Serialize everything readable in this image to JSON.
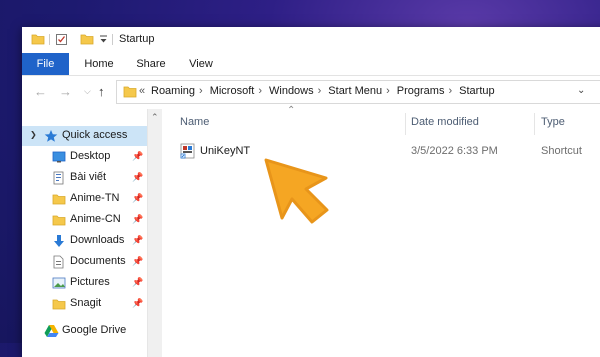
{
  "window": {
    "title": "Startup"
  },
  "ribbon": {
    "tabs": [
      {
        "label": "File"
      },
      {
        "label": "Home"
      },
      {
        "label": "Share"
      },
      {
        "label": "View"
      }
    ]
  },
  "address": {
    "overflow": "«",
    "crumbs": [
      "Roaming",
      "Microsoft",
      "Windows",
      "Start Menu",
      "Programs",
      "Startup"
    ],
    "separator": "›"
  },
  "sidebar": {
    "items": [
      {
        "label": "Quick access",
        "icon": "star-icon"
      },
      {
        "label": "Desktop",
        "icon": "desktop-icon",
        "pinned": true
      },
      {
        "label": "Bài viết",
        "icon": "document-folder-icon",
        "pinned": true
      },
      {
        "label": "Anime-TN",
        "icon": "folder-icon",
        "pinned": true
      },
      {
        "label": "Anime-CN",
        "icon": "folder-icon",
        "pinned": true
      },
      {
        "label": "Downloads",
        "icon": "download-icon",
        "pinned": true
      },
      {
        "label": "Documents",
        "icon": "documents-icon",
        "pinned": true
      },
      {
        "label": "Pictures",
        "icon": "pictures-icon",
        "pinned": true
      },
      {
        "label": "Snagit",
        "icon": "folder-icon",
        "pinned": true
      },
      {
        "label": "Google Drive",
        "icon": "google-drive-icon"
      }
    ]
  },
  "columns": {
    "name": "Name",
    "date": "Date modified",
    "type": "Type"
  },
  "files": [
    {
      "name": "UniKeyNT",
      "date": "3/5/2022 6:33 PM",
      "type": "Shortcut",
      "icon": "shortcut-icon"
    }
  ],
  "colors": {
    "accent": "#1f63c9",
    "folder": "#f5c84b",
    "cursor": "#f5a623",
    "selection": "#cce4f7"
  }
}
